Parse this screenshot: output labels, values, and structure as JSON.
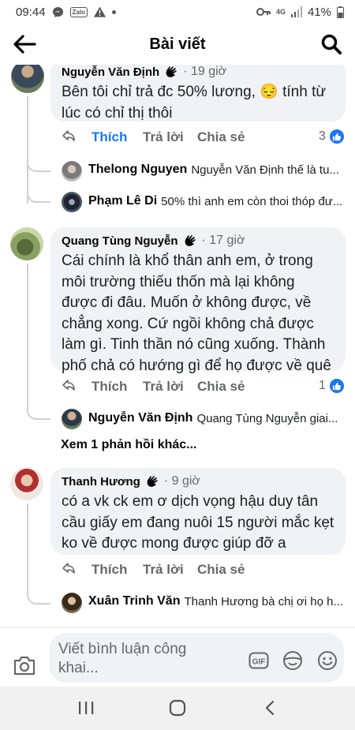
{
  "status": {
    "time": "09:44",
    "battery": "41%",
    "network": "4G"
  },
  "header": {
    "title": "Bài viết"
  },
  "comments": [
    {
      "name": "Nguyễn Văn Định",
      "time": "· 19 giờ",
      "text": "Bên tôi chỉ trả đc 50% lương, 😔 tính từ lúc có chỉ thị thôi",
      "like": "Thích",
      "reply": "Trả lời",
      "share": "Chia sẻ",
      "reactions": "3",
      "replies": [
        {
          "name": "Thelong Nguyen",
          "text": "Nguyễn Văn Định thế là tu..."
        },
        {
          "name": "Phạm Lê Di",
          "text": "50% thì anh em còn thoi thóp đư..."
        }
      ]
    },
    {
      "name": "Quang Tùng Nguyễn",
      "time": "· 17 giờ",
      "text": "Cái chính là khổ thân anh em, ở trong môi trường thiếu thốn mà lại không được đi đâu. Muốn ở không được, về chẳng xong. Cứ ngồi không chả được làm gì. Tinh thần nó cũng xuống. Thành phố chả có hướng gì để họ được về quê",
      "like": "Thích",
      "reply": "Trả lời",
      "share": "Chia sẻ",
      "reactions": "1",
      "replies": [
        {
          "name": "Nguyễn Văn Định",
          "text": "Quang Tùng Nguyễn  giai..."
        }
      ],
      "more": "Xem 1 phản hồi khác..."
    },
    {
      "name": "Thanh Hương",
      "time": "· 9 giờ",
      "text": "có a vk ck em ơ dịch vọng hậu duy tân cầu giấy em đang nuôi 15 người mắc kẹt ko về được mong được giúp đỡ a",
      "like": "Thích",
      "reply": "Trả lời",
      "share": "Chia sẻ",
      "replies": [
        {
          "name": "Xuân Trinh Văn",
          "text": "Thanh Hương bà chị ơi họ h..."
        }
      ]
    }
  ],
  "composer": {
    "placeholder": "Viết bình luận công khai..."
  },
  "colors": {
    "accent": "#1877f2",
    "bubble": "#f0f2f5",
    "secondary_text": "#65676b"
  }
}
